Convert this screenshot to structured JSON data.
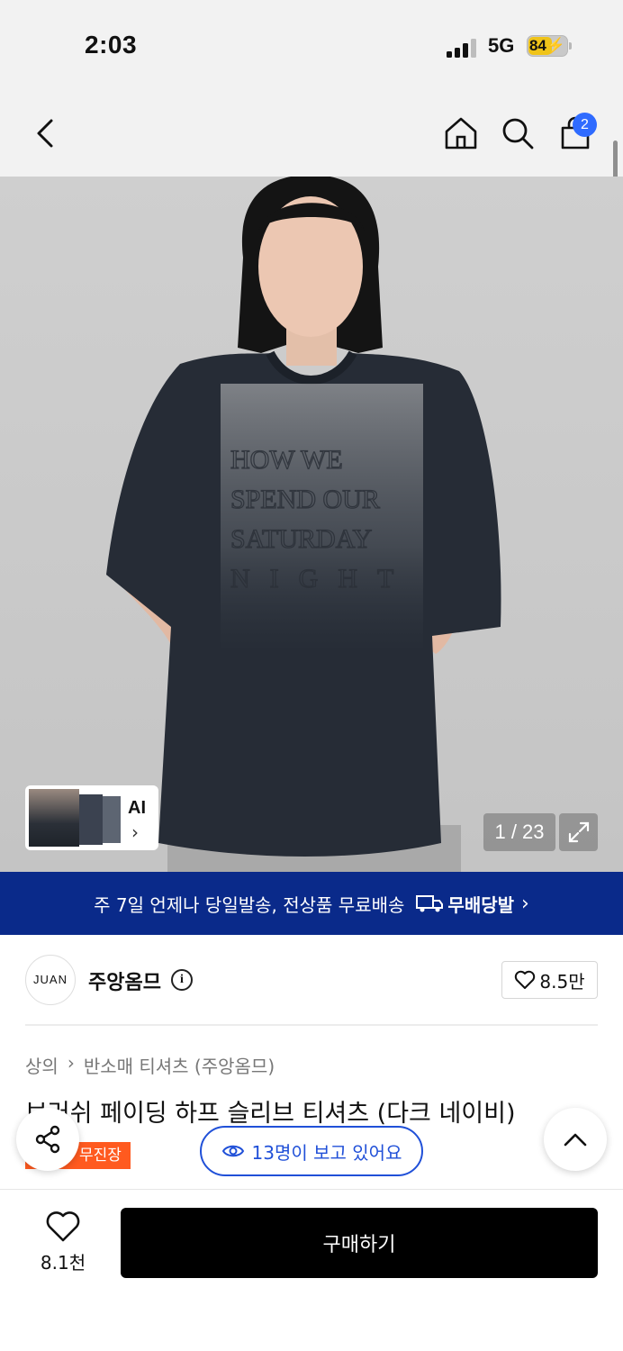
{
  "status_bar": {
    "time": "2:03",
    "network": "5G",
    "battery": "84"
  },
  "nav": {
    "cart_count": "2"
  },
  "gallery": {
    "ai_label": "AI",
    "page_counter": "1 / 23",
    "shirt_print": [
      "HOW WE",
      "SPEND OUR",
      "SATURDAY",
      "NIGHT"
    ]
  },
  "banner": {
    "text": "주 7일 언제나 당일발송, 전상품 무료배송",
    "badge": "무배당발"
  },
  "brand": {
    "logo_text": "JUAN",
    "name": "주앙옴므",
    "likes": "8.5만"
  },
  "breadcrumb": {
    "items": [
      "상의",
      "반소매 티셔츠 (주앙옴므)"
    ]
  },
  "product": {
    "title": "브러쉬 페이딩 하프 슬리브 티셔츠 (다크 네이비)",
    "badge": "무진장"
  },
  "viewers": {
    "text": "13명이 보고 있어요"
  },
  "bottom": {
    "wish_count": "8.1천",
    "buy_label": "구매하기"
  }
}
